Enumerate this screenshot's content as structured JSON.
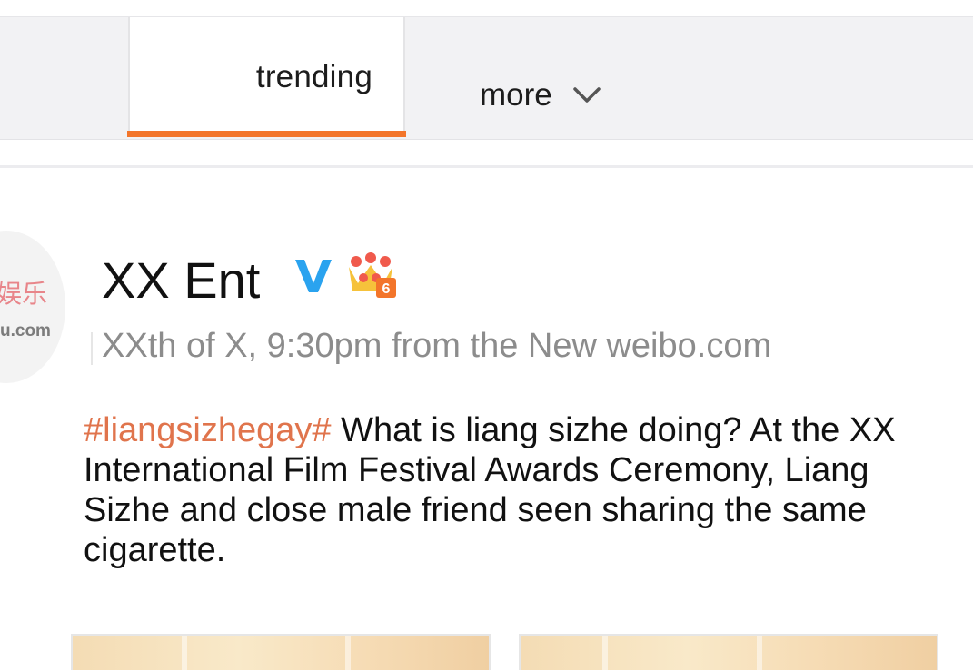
{
  "tabs": {
    "trending_label": "trending",
    "more_label": "more",
    "active_color": "#f3752a"
  },
  "post": {
    "avatar": {
      "chinese_text": "娱乐",
      "domain_text": "u.com"
    },
    "author_name": "XX Ent",
    "verified_badge_letter": "V",
    "crown_level": "6",
    "timestamp_source": "XXth of X, 9:30pm from the New weibo.com",
    "hashtag": "#liangsizhegay#",
    "body": " What is liang sizhe doing? At the XX International Film Festival Awards Ceremony, Liang Sizhe and close male friend seen sharing the same cigarette.",
    "hashtag_color": "#e0744c",
    "verified_color": "#2aa3ef"
  }
}
